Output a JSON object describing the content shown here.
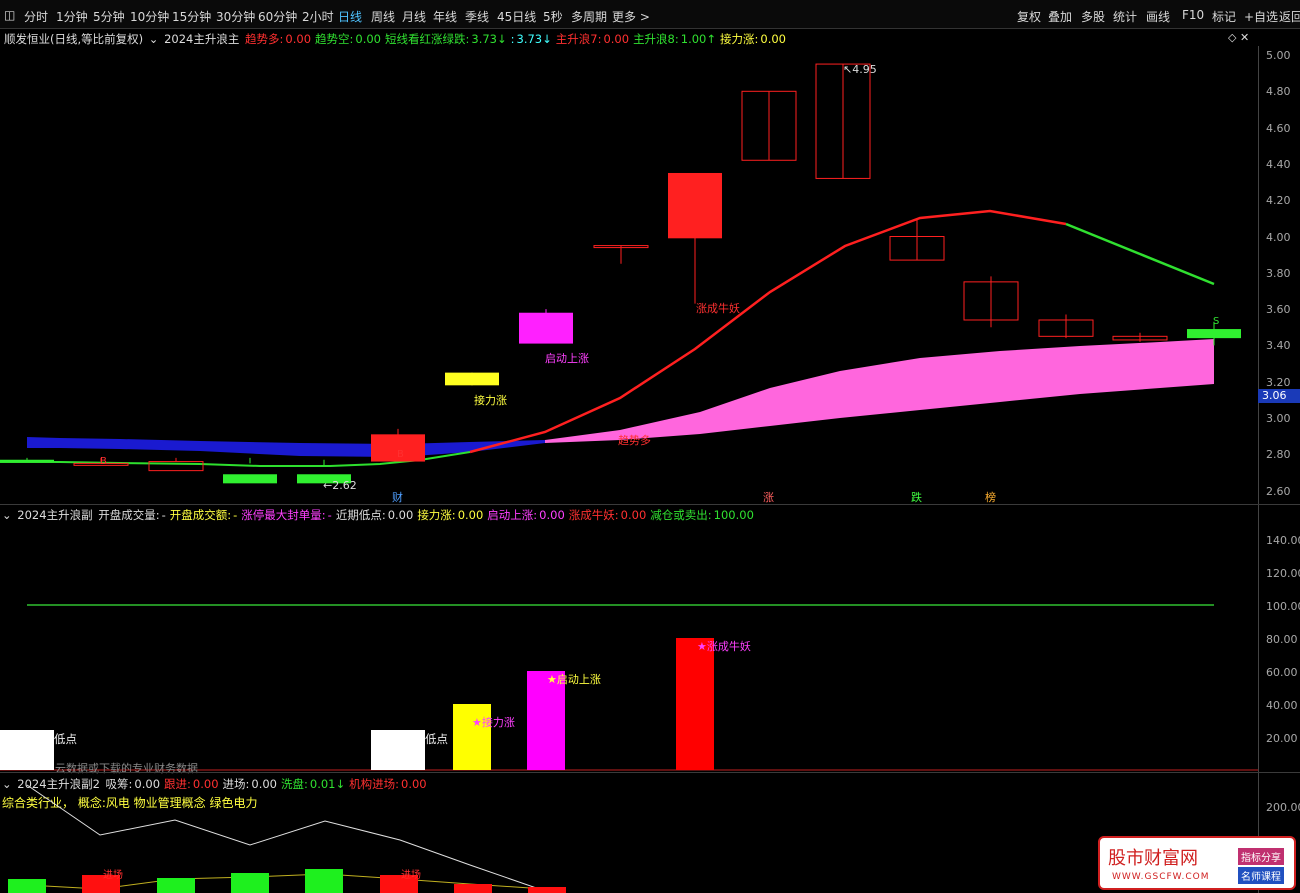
{
  "toolbar": {
    "left_items": [
      "分时",
      "1分钟",
      "5分钟",
      "10分钟",
      "15分钟",
      "30分钟",
      "60分钟",
      "2小时",
      "日线",
      "周线",
      "月线",
      "年线",
      "季线",
      "45日线",
      "5秒",
      "多周期",
      "更多 >"
    ],
    "active": "日线",
    "right_items": [
      "复权",
      "叠加",
      "多股",
      "统计",
      "画线",
      "F10",
      "标记",
      "+自选",
      "返回"
    ]
  },
  "main_panel": {
    "title": "顺发恒业(日线,等比前复权)",
    "indicator": "2024主升浪主",
    "fields": [
      {
        "label": "趋势多:",
        "value": "0.00",
        "color": "red"
      },
      {
        "label": "趋势空:",
        "value": "0.00",
        "color": "green"
      },
      {
        "label": "短线看红涨绿跌:",
        "value": "3.73↓",
        "color": "green"
      },
      {
        "label": ":",
        "value": "3.73↓",
        "color": "cyan"
      },
      {
        "label": "主升浪7:",
        "value": "0.00",
        "color": "red"
      },
      {
        "label": "主升浪8:",
        "value": "1.00↑",
        "color": "green"
      },
      {
        "label": "接力涨:",
        "value": "0.00",
        "color": "yellow"
      }
    ],
    "price_ticks": [
      "5.00",
      "4.80",
      "4.60",
      "4.40",
      "4.20",
      "4.00",
      "3.80",
      "3.60",
      "3.40",
      "3.20",
      "3.00",
      "2.80",
      "2.60"
    ],
    "current_price": "3.06",
    "high_label": "4.95",
    "low_label": "2.62",
    "annotations": {
      "zhangcheng": "涨成牛妖",
      "qidong": "启动上涨",
      "jieli": "接力涨",
      "qushi": "趋势多"
    },
    "bottom_markers": [
      {
        "text": "财",
        "color": "#4f9fff"
      },
      {
        "text": "涨",
        "color": "#ff6060"
      },
      {
        "text": "跌",
        "color": "#40ff40"
      },
      {
        "text": "榜",
        "color": "#ffb030"
      }
    ],
    "candles": [
      {
        "o": 2.77,
        "c": 2.77,
        "h": 2.78,
        "l": 2.76,
        "color": "up"
      },
      {
        "o": 2.77,
        "c": 2.77,
        "h": 2.78,
        "l": 2.76,
        "color": "up"
      },
      {
        "o": 2.77,
        "c": 2.77,
        "h": 2.78,
        "l": 2.76,
        "color": "up"
      },
      {
        "o": 2.76,
        "c": 2.76,
        "h": 2.78,
        "l": 2.75,
        "color": "up"
      },
      {
        "o": 2.75,
        "c": 2.75,
        "h": 2.77,
        "l": 2.74,
        "color": "up"
      },
      {
        "o": 2.92,
        "c": 2.92,
        "h": 2.94,
        "l": 2.84,
        "color": "up"
      },
      {
        "o": 3.25,
        "c": 3.25,
        "h": 3.25,
        "l": 3.18,
        "color": "up"
      },
      {
        "o": 3.58,
        "c": 3.58,
        "h": 3.6,
        "l": 3.42,
        "color": "up"
      },
      {
        "o": 3.95,
        "c": 3.95,
        "h": 3.95,
        "l": 3.85,
        "color": "up"
      },
      {
        "o": 4.35,
        "c": 4.35,
        "h": 4.35,
        "l": 3.63,
        "color": "up"
      },
      {
        "o": 4.8,
        "c": 4.8,
        "h": 4.8,
        "l": 4.42,
        "color": "up"
      },
      {
        "o": 4.95,
        "c": 4.95,
        "h": 4.95,
        "l": 4.32,
        "color": "up"
      },
      {
        "o": 4.0,
        "c": 4.0,
        "h": 4.1,
        "l": 3.87,
        "color": "up"
      },
      {
        "o": 3.75,
        "c": 3.75,
        "h": 3.78,
        "l": 3.5,
        "color": "up"
      },
      {
        "o": 3.54,
        "c": 3.54,
        "h": 3.57,
        "l": 3.44,
        "color": "up"
      },
      {
        "o": 3.45,
        "c": 3.45,
        "h": 3.47,
        "l": 3.42,
        "color": "up"
      },
      {
        "o": 3.49,
        "c": 3.49,
        "h": 3.53,
        "l": 3.4,
        "color": "down"
      }
    ]
  },
  "sub_panel": {
    "indicator": "2024主升浪副",
    "fields": [
      {
        "label": "开盘成交量:",
        "value": "-",
        "color": "white"
      },
      {
        "label": "开盘成交额:",
        "value": "-",
        "color": "yellow"
      },
      {
        "label": "涨停最大封单量:",
        "value": "-",
        "color": "mag"
      },
      {
        "label": "近期低点:",
        "value": "0.00",
        "color": "white"
      },
      {
        "label": "接力涨:",
        "value": "0.00",
        "color": "yellow"
      },
      {
        "label": "启动上涨:",
        "value": "0.00",
        "color": "mag"
      },
      {
        "label": "涨成牛妖:",
        "value": "0.00",
        "color": "red"
      },
      {
        "label": "减仓或卖出:",
        "value": "100.00",
        "color": "green"
      }
    ],
    "ticks": [
      "140.00",
      "120.00",
      "100.00",
      "80.00",
      "60.00",
      "40.00",
      "20.00"
    ],
    "bar_labels": {
      "jieli": "★接力涨",
      "qidong": "★启动上涨",
      "zhangcheng": "★涨成牛妖"
    },
    "low_label": "低点",
    "note": "云数据或下载的专业财务数据",
    "bars": [
      {
        "name": "接力涨",
        "value": 40,
        "color": "#ffff00"
      },
      {
        "name": "启动上涨",
        "value": 60,
        "color": "#ff00ff"
      },
      {
        "name": "涨成牛妖",
        "value": 80,
        "color": "#ff0000"
      }
    ]
  },
  "sub2_panel": {
    "indicator": "2024主升浪副2",
    "fields": [
      {
        "label": "吸筹:",
        "value": "0.00",
        "color": "white"
      },
      {
        "label": "跟进:",
        "value": "0.00",
        "color": "red"
      },
      {
        "label": "进场:",
        "value": "0.00",
        "color": "white"
      },
      {
        "label": "洗盘:",
        "value": "0.01↓",
        "color": "green"
      },
      {
        "label": "机构进场:",
        "value": "0.00",
        "color": "red"
      }
    ],
    "industry_line": "综合类行业， 概念:风电 物业管理概念 绿色电力",
    "tick": "200.00",
    "jinchang": "进场"
  },
  "watermark": {
    "title": "股市财富网",
    "url": "WWW.GSCFW.COM",
    "badge1": "指标分享",
    "badge2": "名师课程"
  }
}
